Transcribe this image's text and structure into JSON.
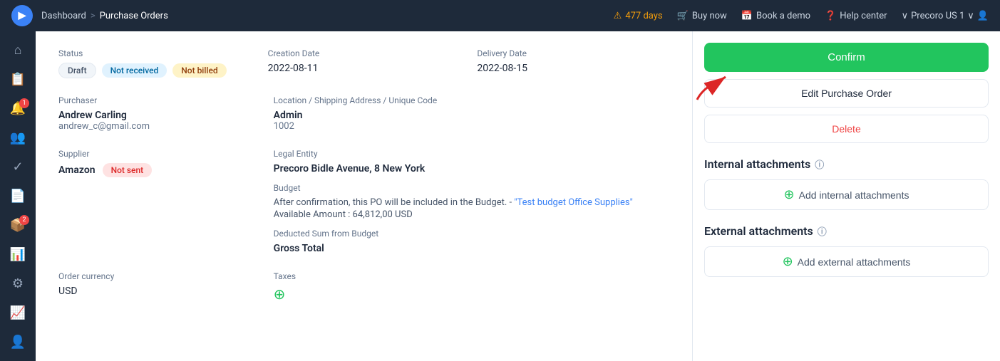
{
  "topnav": {
    "logo": "▶",
    "breadcrumb": {
      "home": "Dashboard",
      "separator1": ">",
      "current": "Purchase Orders"
    },
    "warning": {
      "icon": "⚠",
      "text": "477 days"
    },
    "buy_now": "Buy now",
    "book_demo": "Book a demo",
    "help_center": "Help center",
    "user": "Precoro US 1"
  },
  "sidebar": {
    "icons": [
      {
        "name": "home-icon",
        "glyph": "⌂"
      },
      {
        "name": "orders-icon",
        "glyph": "📋"
      },
      {
        "name": "alert-icon",
        "glyph": "🔔",
        "badge": "1"
      },
      {
        "name": "people-icon",
        "glyph": "👥"
      },
      {
        "name": "checklist-icon",
        "glyph": "✓"
      },
      {
        "name": "invoice-icon",
        "glyph": "📄"
      },
      {
        "name": "receive-icon",
        "glyph": "📦",
        "badge": "2"
      },
      {
        "name": "analytics-icon",
        "glyph": "📊"
      },
      {
        "name": "settings-icon",
        "glyph": "⚙"
      },
      {
        "name": "trend-icon",
        "glyph": "📈"
      },
      {
        "name": "user-icon",
        "glyph": "👤"
      }
    ]
  },
  "status": {
    "label": "Status",
    "badges": {
      "draft": "Draft",
      "not_received": "Not received",
      "not_billed": "Not billed"
    }
  },
  "creation_date": {
    "label": "Creation Date",
    "value": "2022-08-11"
  },
  "delivery_date": {
    "label": "Delivery Date",
    "value": "2022-08-15"
  },
  "purchaser": {
    "label": "Purchaser",
    "name": "Andrew Carling",
    "email": "andrew_c@gmail.com"
  },
  "location": {
    "label": "Location / Shipping Address / Unique Code",
    "name": "Admin",
    "code": "1002"
  },
  "supplier": {
    "label": "Supplier",
    "name": "Amazon",
    "status": "Not sent"
  },
  "legal_entity": {
    "label": "Legal Entity",
    "value": "Precoro Bidle Avenue, 8 New York"
  },
  "budget": {
    "label": "Budget",
    "description": "After confirmation, this PO will be included in the Budget. -",
    "link_text": "\"Test budget Office Supplies\"",
    "available": "Available Amount : 64,812,00 USD"
  },
  "deducted_sum": {
    "label": "Deducted Sum from Budget",
    "value": "Gross Total"
  },
  "order_currency": {
    "label": "Order currency",
    "value": "USD"
  },
  "taxes": {
    "label": "Taxes",
    "icon": "+"
  },
  "actions": {
    "confirm": "Confirm",
    "edit": "Edit Purchase Order",
    "delete": "Delete"
  },
  "internal_attachments": {
    "title": "Internal attachments",
    "add_label": "Add internal attachments"
  },
  "external_attachments": {
    "title": "External attachments",
    "add_label": "Add external attachments"
  }
}
